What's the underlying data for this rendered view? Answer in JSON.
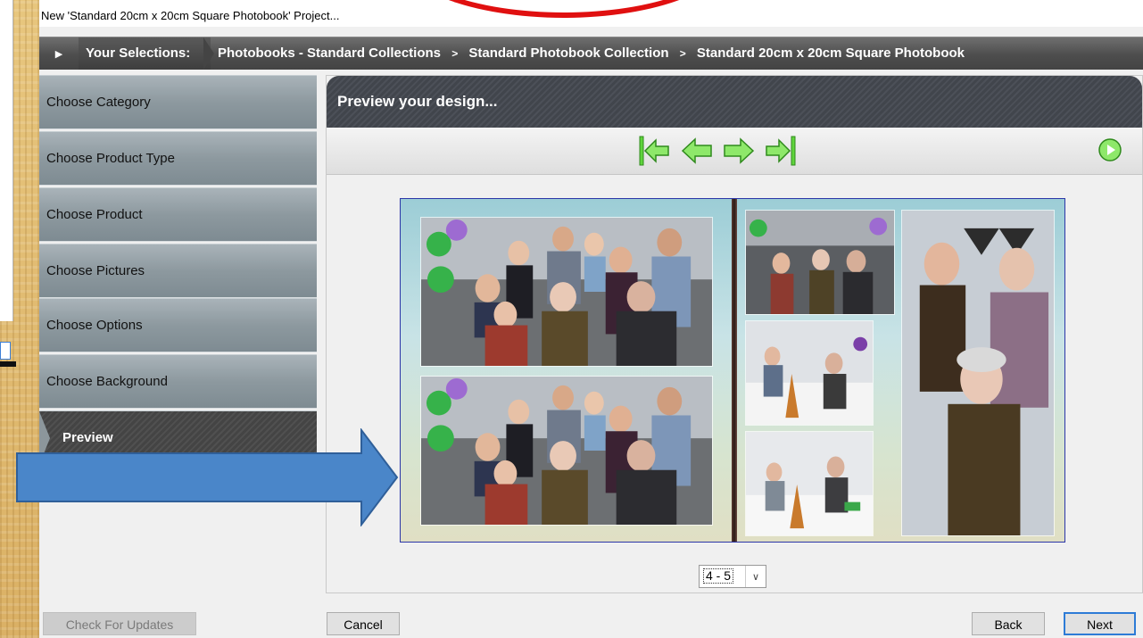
{
  "window": {
    "title": "New 'Standard 20cm x 20cm Square Photobook' Project..."
  },
  "breadcrumb": {
    "label": "Your Selections:",
    "items": [
      "Photobooks - Standard Collections",
      "Standard Photobook Collection",
      "Standard 20cm x 20cm Square Photobook"
    ],
    "separator": ">"
  },
  "sidebar": {
    "items": [
      {
        "label": "Choose Category"
      },
      {
        "label": "Choose Product Type"
      },
      {
        "label": "Choose Product"
      },
      {
        "label": "Choose Pictures"
      },
      {
        "label": "Choose Options"
      },
      {
        "label": "Choose Background"
      },
      {
        "label": "Preview"
      }
    ],
    "active_index": 6
  },
  "panel": {
    "title": "Preview your design...",
    "nav_icons": [
      "first-page-icon",
      "previous-page-icon",
      "next-page-icon",
      "last-page-icon"
    ],
    "go_icon": "play-next-icon",
    "page_selector": {
      "value": "4 - 5"
    }
  },
  "buttons": {
    "check_updates": "Check For Updates",
    "cancel": "Cancel",
    "back": "Back",
    "next": "Next"
  },
  "colors": {
    "accent_green": "#5fd43c",
    "annotation_red": "#e01010",
    "annotation_blue": "#4a86c9",
    "default_button_border": "#2d7bd6"
  }
}
